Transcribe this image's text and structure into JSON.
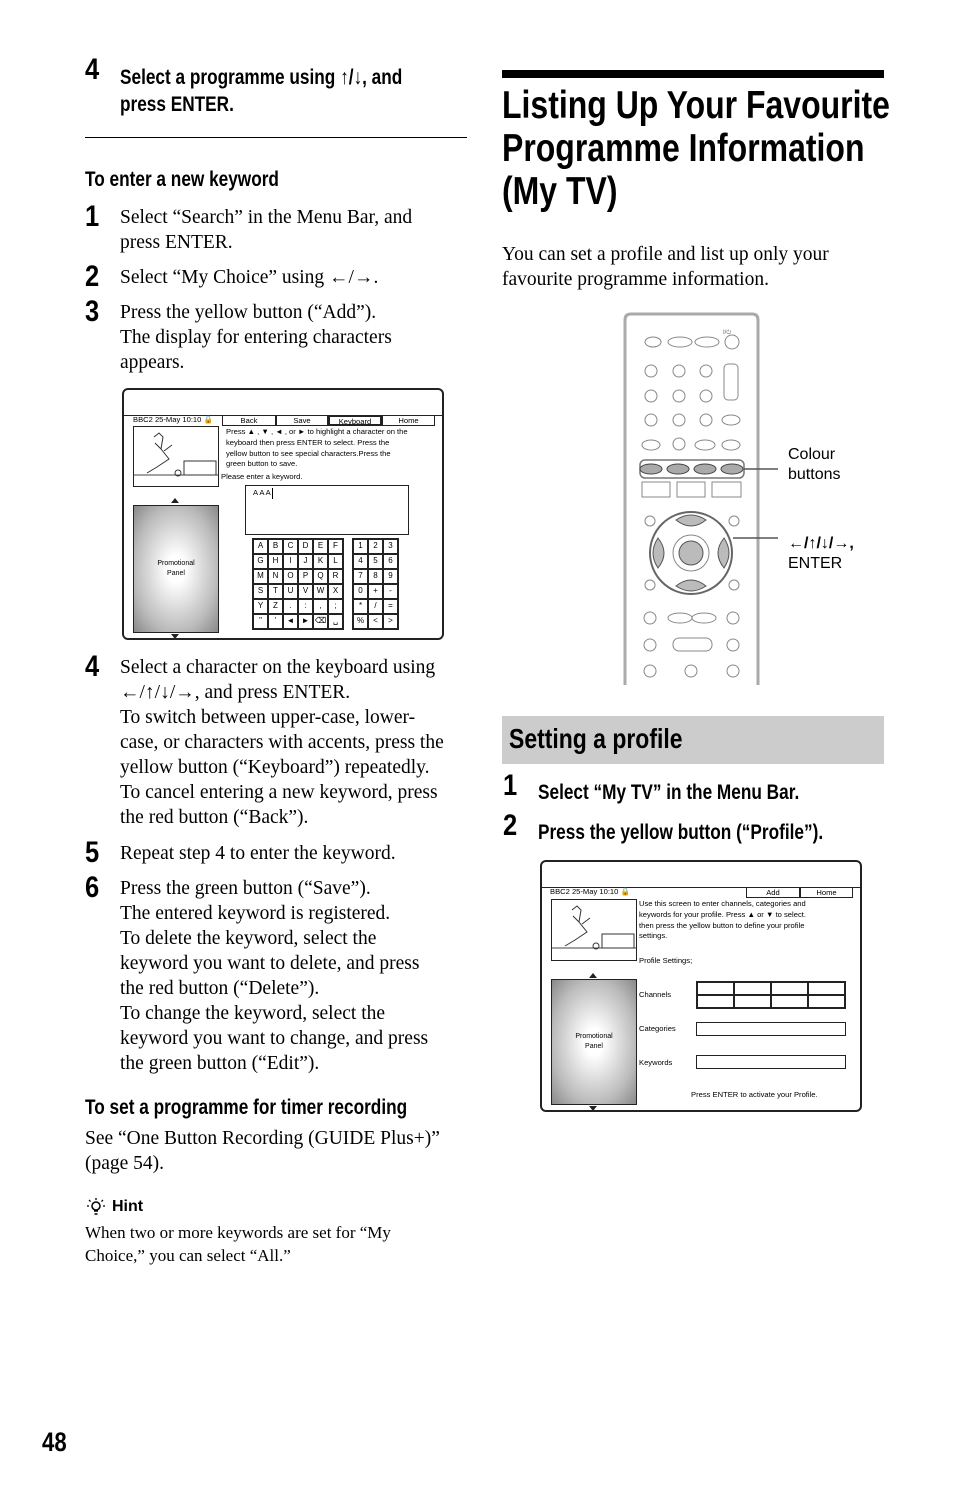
{
  "page_number": "48",
  "left": {
    "step4_top": {
      "num": "4",
      "lines": [
        "Select a programme using ↑/↓, and",
        "press ENTER."
      ]
    },
    "new_keyword": {
      "heading": "To enter a new keyword",
      "steps": [
        {
          "num": "1",
          "lines": [
            "Select “Search” in the Menu Bar, and",
            "press ENTER."
          ]
        },
        {
          "num": "2",
          "lines": [
            "Select “My Choice” using ←/→."
          ]
        },
        {
          "num": "3",
          "lines": [
            "Press the yellow button (“Add”).",
            "The display for entering characters",
            "appears."
          ]
        },
        {
          "num": "4",
          "lines": [
            "Select a character on the keyboard using",
            "←/↑/↓/→, and press ENTER.",
            "To switch between upper-case, lower-",
            "case, or characters with accents, press the",
            "yellow button (“Keyboard”) repeatedly.",
            "To cancel entering a new keyword, press",
            "the red button (“Back”)."
          ]
        },
        {
          "num": "5",
          "lines": [
            "Repeat step 4 to enter the keyword."
          ]
        },
        {
          "num": "6",
          "lines": [
            "Press the green button (“Save”).",
            "The entered keyword is registered.",
            "To delete the keyword, select the",
            "keyword you want to delete, and press",
            "the red button (“Delete”).",
            "To change the keyword, select the",
            "keyword you want to change, and press",
            "the green button (“Edit”)."
          ]
        }
      ]
    },
    "timer": {
      "heading": "To set a programme for timer recording",
      "lines": [
        "See “One Button Recording (GUIDE Plus+)”",
        "(page 54)."
      ]
    },
    "hint": {
      "icon": "lightbulb-icon",
      "label": "Hint",
      "lines": [
        "When two or more keywords are set for “My",
        "Choice,” you can select “All.”"
      ]
    }
  },
  "keyboard_screen": {
    "status": "BBC2  25-May 10:10",
    "buttons": [
      "Back",
      "Save",
      "Keyboard",
      "Home"
    ],
    "selected_button": "Keyboard",
    "instructions": [
      "Press ▲ , ▼ , ◄ , or ► to highlight a character on the",
      "keyboard then press ENTER to select. Press the",
      "yellow button to see special characters.Press the",
      "green button to save."
    ],
    "prompt": "Please enter a keyword.",
    "input_value": "A A A",
    "promo": [
      "Promotional",
      "Panel"
    ],
    "letters": [
      "A",
      "B",
      "C",
      "D",
      "E",
      "F",
      "G",
      "H",
      "I",
      "J",
      "K",
      "L",
      "M",
      "N",
      "O",
      "P",
      "Q",
      "R",
      "S",
      "T",
      "U",
      "V",
      "W",
      "X",
      "Y",
      "Z",
      ".",
      ":",
      ",",
      ";",
      "\"",
      "'",
      "◄",
      "►",
      "⌫",
      "␣"
    ],
    "numbers": [
      "1",
      "2",
      "3",
      "4",
      "5",
      "6",
      "7",
      "8",
      "9",
      "0",
      "+",
      "-",
      "*",
      "/",
      "=",
      "%",
      "<",
      ">"
    ]
  },
  "right": {
    "title_lines": [
      "Listing Up Your Favourite",
      "Programme Information",
      "(My TV)"
    ],
    "intro_lines": [
      "You can set a profile and list up only your",
      "favourite programme information."
    ],
    "remote": {
      "power_label": "I/⏻",
      "label_colour": [
        "Colour",
        "buttons"
      ],
      "label_arrows": [
        "←/↑/↓/→,",
        "ENTER"
      ],
      "colour_button_fill": "#aaaaaa"
    },
    "section": {
      "heading": "Setting a profile",
      "band_color": "#cccccc"
    },
    "steps": [
      {
        "num": "1",
        "text": "Select “My TV” in the Menu Bar."
      },
      {
        "num": "2",
        "text": "Press the yellow button (“Profile”)."
      }
    ]
  },
  "profile_screen": {
    "status": "BBC2  25-May 10:10",
    "buttons": [
      "Add",
      "Home"
    ],
    "instructions": [
      "Use this screen to enter channels, categories and",
      "keywords for your profile. Press ▲ or ▼ to select.",
      "then press the yellow button to define your profile",
      "settings."
    ],
    "settings_label": "Profile Settings;",
    "fields": [
      "Channels",
      "Categories",
      "Keywords"
    ],
    "footer": "Press  ENTER to activate your Profile.",
    "promo": [
      "Promotional",
      "Panel"
    ]
  }
}
